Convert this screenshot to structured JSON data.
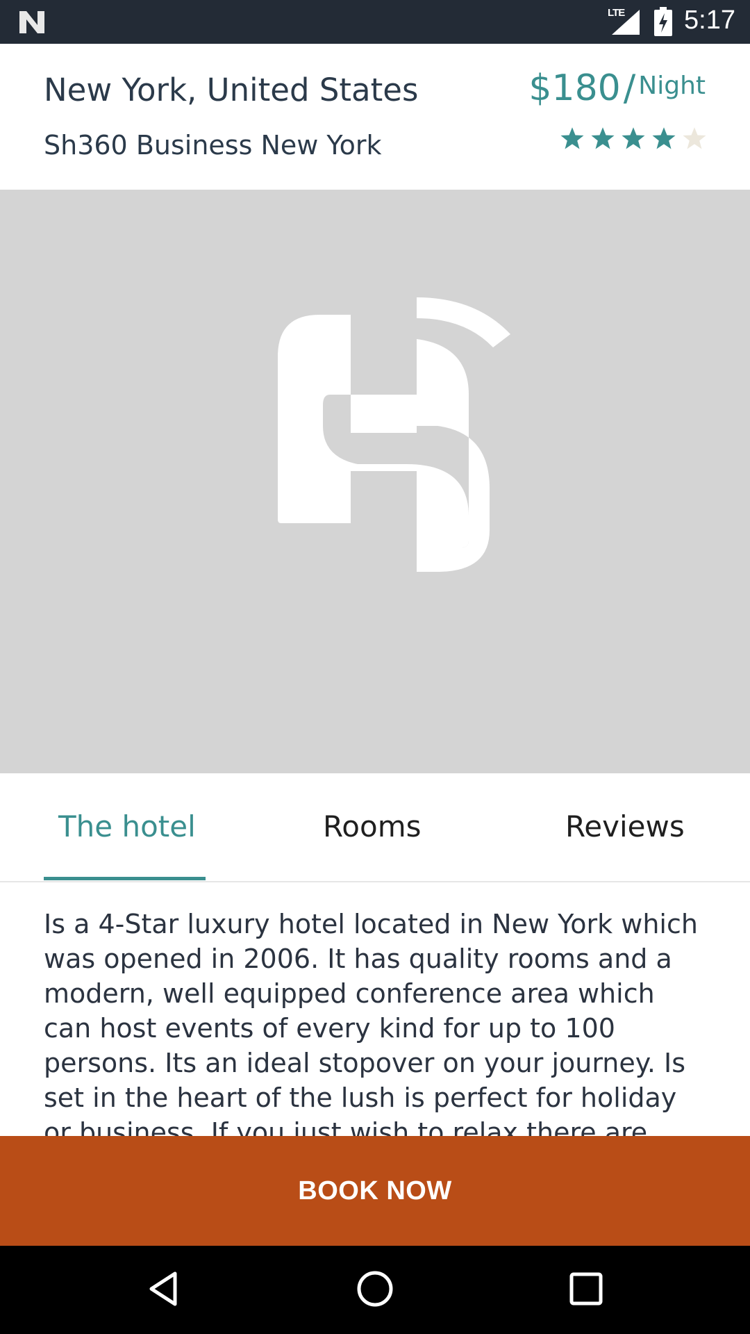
{
  "status_bar": {
    "network": "LTE",
    "time": "5:17"
  },
  "header": {
    "location": "New York, United States",
    "hotel_name": "Sh360 Business New York",
    "price_amount": "$180",
    "price_separator": "/",
    "price_unit": "Night",
    "rating": 4,
    "rating_max": 5,
    "star_color_filled": "#3a8f8f",
    "star_color_empty": "#ece7dc"
  },
  "hero": {
    "icon": "hotel-logo-placeholder-icon",
    "background": "#d4d4d4"
  },
  "tabs": [
    {
      "label": "The hotel",
      "active": true
    },
    {
      "label": "Rooms",
      "active": false
    },
    {
      "label": "Reviews",
      "active": false
    }
  ],
  "description": "Is a 4-Star luxury hotel located in New York which was opened in 2006. It has quality rooms and a modern, well equipped conference area which can host events of every kind for up to 100 persons. Its an ideal stopover on your journey. Is set in the heart of the lush is perfect for holiday or business. If you just wish to relax there are",
  "book_button": {
    "label": "BOOK NOW",
    "color": "#b94d17"
  },
  "nav_bar": {
    "back": "back-icon",
    "home": "home-icon",
    "recents": "recents-icon"
  }
}
